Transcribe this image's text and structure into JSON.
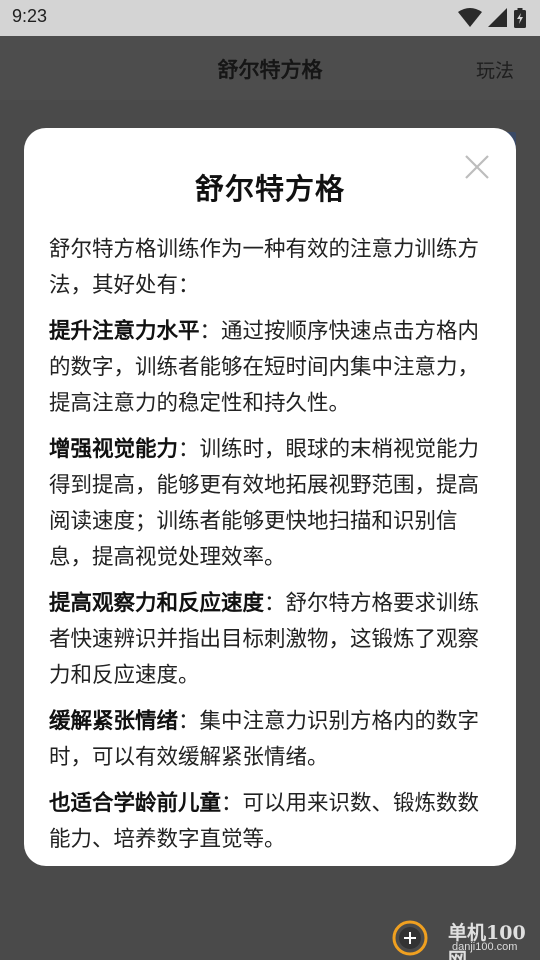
{
  "status_bar": {
    "time": "9:23"
  },
  "header": {
    "title": "舒尔特方格",
    "rules_link": "玩法"
  },
  "dialog": {
    "title": "舒尔特方格",
    "intro": "舒尔特方格训练作为一种有效的注意力训练方法，其好处有：",
    "benefits": [
      {
        "term": "提升注意力水平",
        "text": "：通过按顺序快速点击方格内的数字，训练者能够在短时间内集中注意力，提高注意力的稳定性和持久性。"
      },
      {
        "term": "增强视觉能力",
        "text": "：训练时，眼球的末梢视觉能力得到提高，能够更有效地拓展视野范围，提高阅读速度；训练者能够更快地扫描和识别信息，提高视觉处理效率。"
      },
      {
        "term": "提高观察力和反应速度",
        "text": "：舒尔特方格要求训练者快速辨识并指出目标刺激物，这锻炼了观察力和反应速度。"
      },
      {
        "term": "缓解紧张情绪",
        "text": "：集中注意力识别方格内的数字时，可以有效缓解紧张情绪。"
      },
      {
        "term": "也适合学龄前儿童",
        "text": "：可以用来识数、锻炼数数能力、培养数字直觉等。"
      }
    ],
    "close_icon": "close-icon"
  },
  "watermark": {
    "name": "单机100网",
    "url": "danji100.com"
  },
  "colors": {
    "overlay": "#4a4a4a",
    "status_bar": "#d4d4d4",
    "dialog_bg": "#ffffff",
    "text": "#222222",
    "close_icon": "#bdbdbd"
  }
}
